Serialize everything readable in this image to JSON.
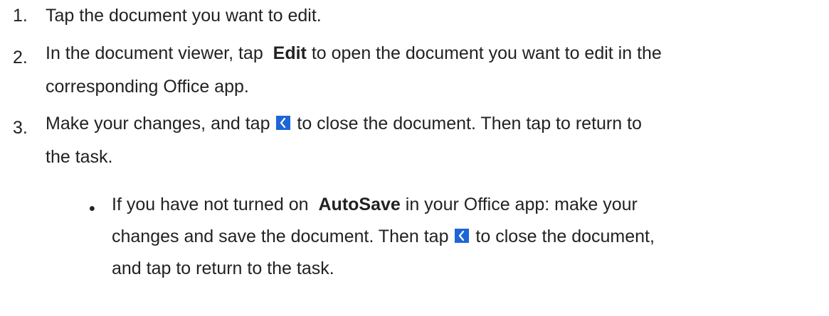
{
  "steps": [
    {
      "number": "1.",
      "text": "Tap the document you want to edit."
    },
    {
      "number": "2.",
      "pre": "In the document viewer, tap",
      "bold": "Edit",
      "post": "to open the document you want to edit in the",
      "line2": "corresponding Office app."
    },
    {
      "number": "3.",
      "pre": "Make your changes, and tap",
      "post": "to close the document. Then tap  to return to",
      "line2": "the task."
    }
  ],
  "substep": {
    "bullet": "•",
    "pre": "If you have not turned on",
    "bold": "AutoSave",
    "post": "in your Office app: make your",
    "line2_pre": "changes and save the document. Then tap",
    "line2_post": "to close the document,",
    "line3": "and tap to return to the task."
  },
  "icons": {
    "back": "chevron-left-icon"
  },
  "colors": {
    "text": "#222222",
    "icon_bg": "#1e66d6",
    "icon_fg": "#ffffff"
  }
}
